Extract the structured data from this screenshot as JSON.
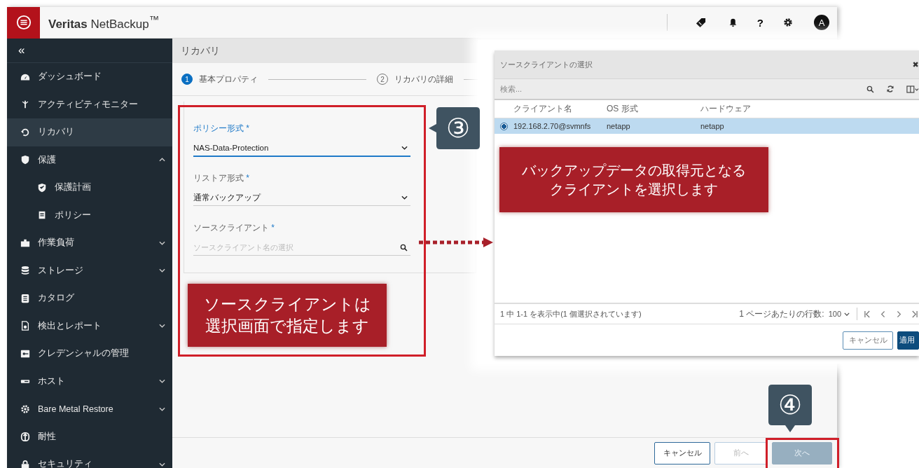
{
  "header": {
    "brand": "**Veritas** NetBackup$^{™}$",
    "help": "?",
    "avatar": "A"
  },
  "sidebar": {
    "collapse": "«",
    "items": [
      {
        "label": "ダッシュボード",
        "kind": "link",
        "selected": false
      },
      {
        "label": "アクティビティモニター",
        "kind": "link",
        "selected": false
      },
      {
        "label": "リカバリ",
        "kind": "link",
        "selected": true
      },
      {
        "label": "保護",
        "kind": "group",
        "selected": false,
        "expanded": true,
        "children": [
          {
            "label": "保護計画",
            "selected": false
          },
          {
            "label": "ポリシー",
            "selected": false
          }
        ]
      },
      {
        "label": "作業負荷",
        "kind": "group",
        "selected": false,
        "expanded": false
      },
      {
        "label": "ストレージ",
        "kind": "group",
        "selected": false,
        "expanded": false
      },
      {
        "label": "カタログ",
        "kind": "link",
        "selected": false
      },
      {
        "label": "検出とレポート",
        "kind": "group",
        "selected": false,
        "expanded": false
      },
      {
        "label": "クレデンシャルの管理",
        "kind": "link",
        "selected": false
      },
      {
        "label": "ホスト",
        "kind": "group",
        "selected": false,
        "expanded": false
      },
      {
        "label": "Bare Metal Restore",
        "kind": "group",
        "selected": false,
        "expanded": false
      },
      {
        "label": "耐性",
        "kind": "link",
        "selected": false
      },
      {
        "label": "セキュリティ",
        "kind": "group",
        "selected": false,
        "expanded": false
      }
    ]
  },
  "page": {
    "title": "リカバリ",
    "steps": [
      {
        "number": "1",
        "label": "基本プロパティ",
        "selected": true
      },
      {
        "number": "2",
        "label": "リカバリの詳細",
        "selected": false
      }
    ],
    "fields": [
      {
        "label": "ポリシー形式",
        "required_mark": "*",
        "kind": "select",
        "value": "NAS-Data-Protection",
        "focused": true
      },
      {
        "label": "リストア形式",
        "required_mark": "*",
        "kind": "select",
        "value": "通常バックアップ",
        "focused": false
      },
      {
        "label": "ソースクライアント",
        "required_mark": "*",
        "kind": "search",
        "placeholder": "ソースクライアント名の選択",
        "focused": false
      }
    ],
    "buttons": [
      {
        "label": "キャンセル",
        "kind": "secondary",
        "disabled": false
      },
      {
        "label": "前へ",
        "kind": "secondary",
        "disabled": true
      },
      {
        "label": "次へ",
        "kind": "primary",
        "disabled": true
      }
    ]
  },
  "dialog": {
    "title": "ソースクライアントの選択",
    "close": "✖",
    "search": {
      "placeholder": "検索..."
    },
    "columns": [
      "クライアント名",
      "OS 形式",
      "ハードウェア"
    ],
    "rows": [
      {
        "cells": [
          "192.168.2.70@svmnfs",
          "netapp",
          "netapp"
        ],
        "selected": true
      }
    ],
    "status": "1 中 1-1 を表示中(1 個選択されています)",
    "rows_per_page_label": "1 ページあたりの行数:",
    "rows_per_page": "100",
    "buttons": [
      {
        "label": "キャンセル",
        "kind": "secondary"
      },
      {
        "label": "適用",
        "kind": "primary"
      }
    ]
  },
  "annotations": {
    "callouts": [
      {
        "label": "③"
      },
      {
        "label": "④"
      }
    ],
    "notes": [
      {
        "text": "ソースクライアントは選択画面で指定します"
      },
      {
        "text": "バックアップデータの取得元となるクライアントを選択します"
      }
    ]
  }
}
